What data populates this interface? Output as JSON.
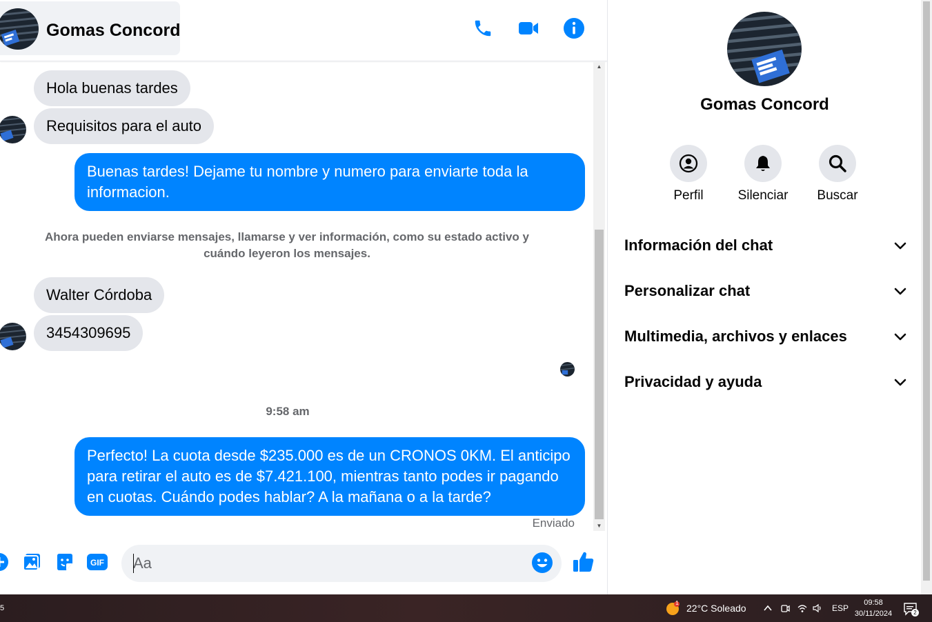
{
  "header": {
    "contact_name": "Gomas Concord"
  },
  "messages": {
    "in_1": "Hola buenas tardes",
    "in_2": "Requisitos para el auto",
    "out_1": "Buenas tardes! Dejame tu nombre y numero para enviarte toda la informacion.",
    "system_notice": "Ahora pueden enviarse mensajes, llamarse y ver información, como su estado activo y cuándo leyeron los mensajes.",
    "in_3": "Walter Córdoba",
    "in_4": "3454309695",
    "timestamp": "9:58 am",
    "out_2": "Perfecto! La cuota desde $235.000 es de un CRONOS 0KM. El anticipo para retirar el auto es de $7.421.100, mientras tanto podes ir pagando en cuotas. Cuándo podes hablar? A la mañana o a la tarde?",
    "status": "Enviado"
  },
  "composer": {
    "placeholder": "Aa",
    "gif_label": "GIF"
  },
  "info_panel": {
    "name": "Gomas Concord",
    "actions": [
      {
        "label": "Perfil",
        "icon": "profile-icon"
      },
      {
        "label": "Silenciar",
        "icon": "bell-icon"
      },
      {
        "label": "Buscar",
        "icon": "search-icon"
      }
    ],
    "sections": [
      {
        "label": "Información del chat"
      },
      {
        "label": "Personalizar chat"
      },
      {
        "label": "Multimedia, archivos y enlaces"
      },
      {
        "label": "Privacidad y ayuda"
      }
    ]
  },
  "taskbar": {
    "weather": "22°C  Soleado",
    "weather_badge": "1",
    "language": "ESP",
    "time": "09:58",
    "date": "30/11/2024",
    "notifications": "2",
    "left_badge": "5"
  },
  "colors": {
    "accent": "#0084ff",
    "incoming_bubble": "#e4e6eb",
    "muted_text": "#65676b"
  }
}
